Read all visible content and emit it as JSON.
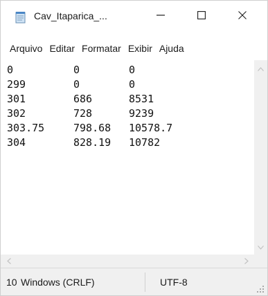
{
  "window": {
    "title": "Cav_Itaparica_...",
    "icon": "notepad-icon",
    "controls": {
      "minimize": "minimize-icon",
      "maximize": "maximize-icon",
      "close": "close-icon"
    }
  },
  "menu": [
    "Arquivo",
    "Editar",
    "Formatar",
    "Exibir",
    "Ajuda"
  ],
  "editor": {
    "rows": [
      [
        "0",
        "0",
        "0"
      ],
      [
        "299",
        "0",
        "0"
      ],
      [
        "301",
        "686",
        "8531"
      ],
      [
        "302",
        "728",
        "9239"
      ],
      [
        "303.75",
        "798.68",
        "10578.7"
      ],
      [
        "304",
        "828.19",
        "10782"
      ]
    ]
  },
  "status": {
    "position": "10",
    "line_ending": "Windows (CRLF)",
    "encoding": "UTF-8"
  },
  "colors": {
    "chrome": "#f0f0f0",
    "text": "#1a1a1a",
    "scroll_arrow": "#c2c2c2"
  }
}
